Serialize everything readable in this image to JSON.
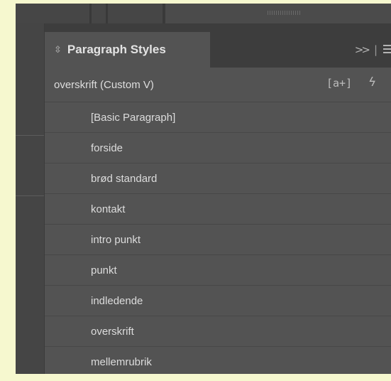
{
  "panel": {
    "tab_label": "Paragraph Styles",
    "tab_icon": "double-chevron",
    "collapse_glyph": ">>",
    "separator": "|",
    "current_style": "overskrift (Custom V)",
    "new_style_glyph": "[a+]",
    "clear_overrides_glyph": "ϟ"
  },
  "styles": [
    "[Basic Paragraph]",
    "forside",
    "brød standard",
    "kontakt",
    "intro punkt",
    "punkt",
    "indledende",
    "overskrift",
    "mellemrubrik"
  ],
  "colors": {
    "page_background": "#f6f8cf",
    "panel": "#535353",
    "header": "#3d3d3d",
    "text": "#dcdcdc"
  }
}
